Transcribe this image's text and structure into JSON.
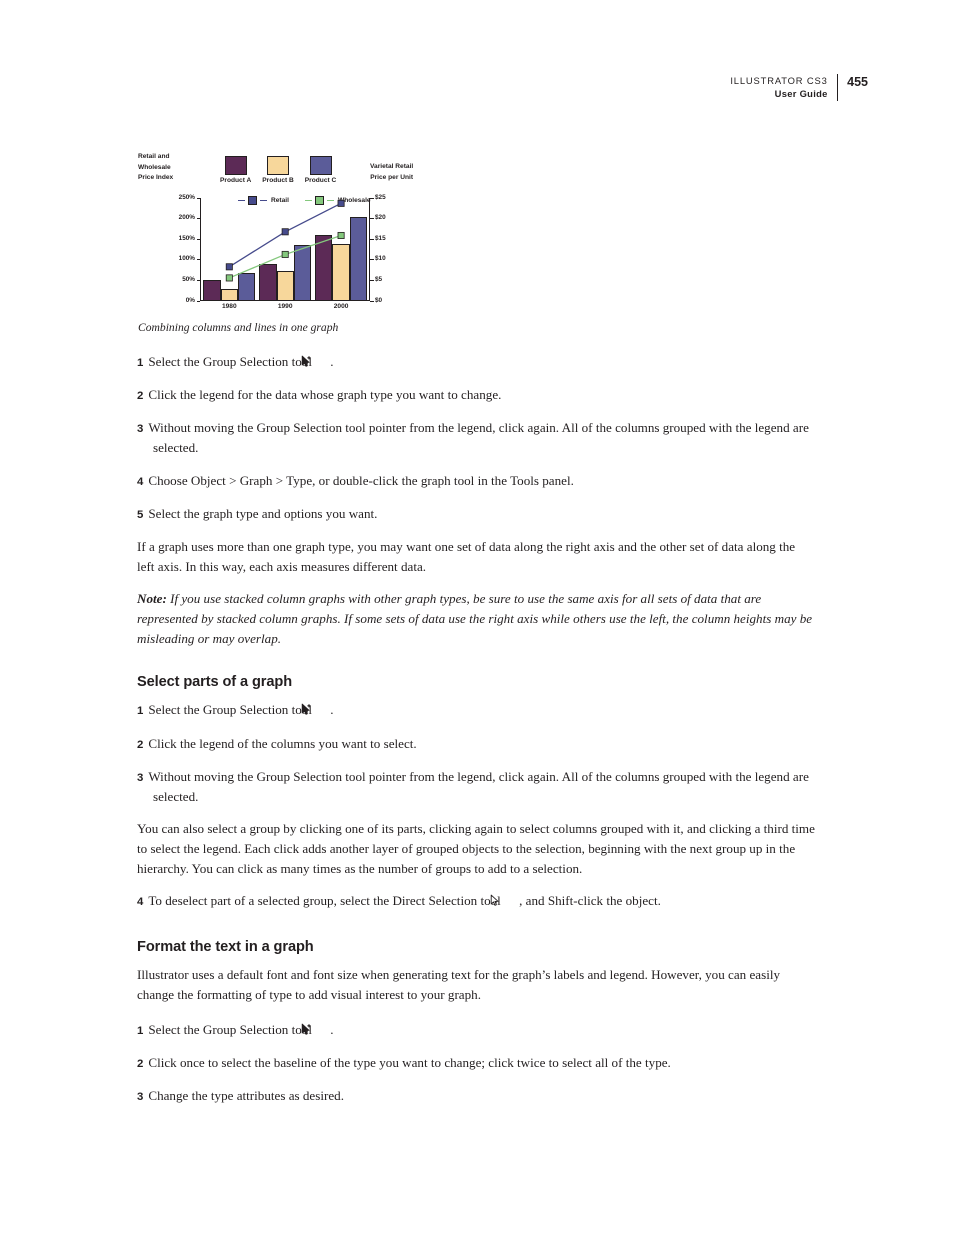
{
  "header": {
    "product": "ILLUSTRATOR CS3",
    "doc": "User Guide",
    "page_number": "455"
  },
  "figure": {
    "caption": "Combining columns and lines in one graph",
    "left_axis_title": "Retail and\nWholesale\nPrice Index",
    "right_axis_title": "Varietal Retail\nPrice per Unit"
  },
  "chart_data": {
    "type": "bar",
    "title": "",
    "categories": [
      "1980",
      "1990",
      "2000"
    ],
    "left_axis": {
      "label": "Retail and Wholesale Price Index",
      "ticks": [
        "0%",
        "50%",
        "100%",
        "150%",
        "200%",
        "250%"
      ],
      "values": [
        0,
        50,
        100,
        150,
        200,
        250
      ],
      "min": 0,
      "max": 250
    },
    "right_axis": {
      "label": "Varietal Retail Price per Unit",
      "ticks": [
        "$0",
        "$5",
        "$10",
        "$15",
        "$20",
        "$25"
      ],
      "values": [
        0,
        5,
        10,
        15,
        20,
        25
      ],
      "min": 0,
      "max": 25
    },
    "series": [
      {
        "name": "Product A",
        "kind": "column",
        "axis": "left",
        "color": "#5C2A56",
        "values": [
          50,
          90,
          160
        ]
      },
      {
        "name": "Product B",
        "kind": "column",
        "axis": "left",
        "color": "#F7D79B",
        "values": [
          30,
          72,
          138
        ]
      },
      {
        "name": "Product C",
        "kind": "column",
        "axis": "right",
        "color": "#5B5C99",
        "values": [
          6.8,
          13.7,
          20.5
        ]
      },
      {
        "name": "Retail",
        "kind": "line",
        "axis": "left",
        "color": "#464B8C",
        "values": [
          83,
          168,
          237
        ]
      },
      {
        "name": "Wholesale",
        "kind": "line",
        "axis": "left",
        "color": "#84C87D",
        "values": [
          56,
          113,
          159
        ]
      }
    ],
    "grid": false,
    "legend_position": "top"
  },
  "body": {
    "steps_change_type": [
      {
        "num": "1",
        "text_before": "Select the Group Selection tool ",
        "icon": "group-selection-tool",
        "text_after": "."
      },
      {
        "num": "2",
        "text_before": "Click the legend for the data whose graph type you want to change.",
        "icon": null,
        "text_after": ""
      },
      {
        "num": "3",
        "text_before": "Without moving the Group Selection tool pointer from the legend, click again. All of the columns grouped with the legend are selected.",
        "icon": null,
        "text_after": ""
      },
      {
        "num": "4",
        "text_before": "Choose Object > Graph > Type, or double-click the graph tool in the Tools panel.",
        "icon": null,
        "text_after": ""
      },
      {
        "num": "5",
        "text_before": "Select the graph type and options you want.",
        "icon": null,
        "text_after": ""
      }
    ],
    "para_axes": "If a graph uses more than one graph type, you may want one set of data along the right axis and the other set of data along the left axis. In this way, each axis measures different data.",
    "note_lead": "Note:",
    "note_text": " If you use stacked column graphs with other graph types, be sure to use the same axis for all sets of data that are represented by stacked column graphs. If some sets of data use the right axis while others use the left, the column heights may be misleading or may overlap.",
    "heading_select_parts": "Select parts of a graph",
    "steps_select_parts": [
      {
        "num": "1",
        "text_before": "Select the Group Selection tool ",
        "icon": "group-selection-tool",
        "text_after": "."
      },
      {
        "num": "2",
        "text_before": "Click the legend of the columns you want to select.",
        "icon": null,
        "text_after": ""
      },
      {
        "num": "3",
        "text_before": "Without moving the Group Selection tool pointer from the legend, click again. All of the columns grouped with the legend are selected.",
        "icon": null,
        "text_after": ""
      }
    ],
    "para_select_group": "You can also select a group by clicking one of its parts, clicking again to select columns grouped with it, and clicking a third time to select the legend. Each click adds another layer of grouped objects to the selection, beginning with the next group up in the hierarchy. You can click as many times as the number of groups to add to a selection.",
    "step_deselect": {
      "num": "4",
      "text_before": "To deselect part of a selected group, select the Direct Selection tool ",
      "icon": "direct-selection-tool",
      "text_after": ", and Shift-click the object."
    },
    "heading_format_text": "Format the text in a graph",
    "para_format_text": "Illustrator uses a default font and font size when generating text for the graph’s labels and legend. However, you can easily change the formatting of type to add visual interest to your graph.",
    "steps_format_text": [
      {
        "num": "1",
        "text_before": "Select the Group Selection tool ",
        "icon": "group-selection-tool",
        "text_after": "."
      },
      {
        "num": "2",
        "text_before": "Click once to select the baseline of the type you want to change; click twice to select all of the type.",
        "icon": null,
        "text_after": ""
      },
      {
        "num": "3",
        "text_before": "Change the type attributes as desired.",
        "icon": null,
        "text_after": ""
      }
    ]
  }
}
